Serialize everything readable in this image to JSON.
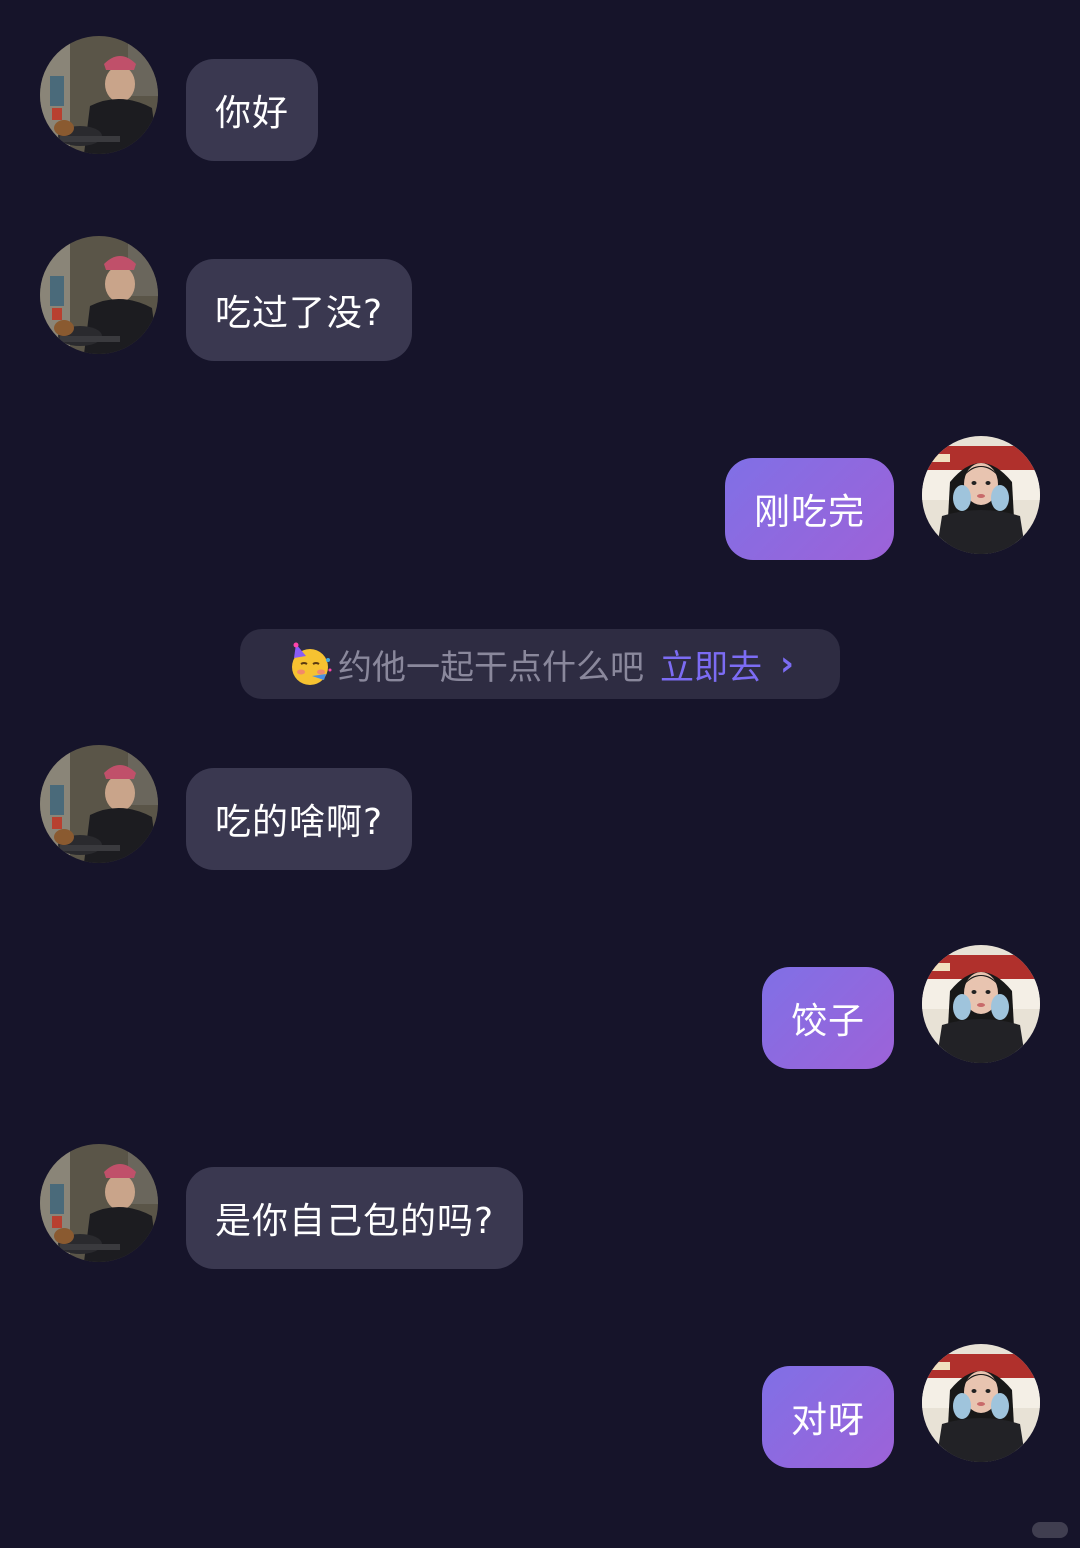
{
  "messages": [
    {
      "side": "left",
      "text": "你好"
    },
    {
      "side": "left",
      "text": "吃过了没?"
    },
    {
      "side": "right",
      "text": "刚吃完"
    },
    {
      "side": "left",
      "text": "吃的啥啊?"
    },
    {
      "side": "right",
      "text": "饺子"
    },
    {
      "side": "left",
      "text": "是你自己包的吗?"
    },
    {
      "side": "right",
      "text": "对呀"
    }
  ],
  "suggestion": {
    "emoji": "party-face-icon",
    "prompt": "约他一起干点什么吧",
    "cta": "立即去",
    "chevron": "›"
  },
  "colors": {
    "background": "#16142a",
    "incoming_bubble": "#3a3850",
    "outgoing_bubble_start": "#8070e6",
    "outgoing_bubble_end": "#9d62d8",
    "cta": "#7c6cf4"
  }
}
